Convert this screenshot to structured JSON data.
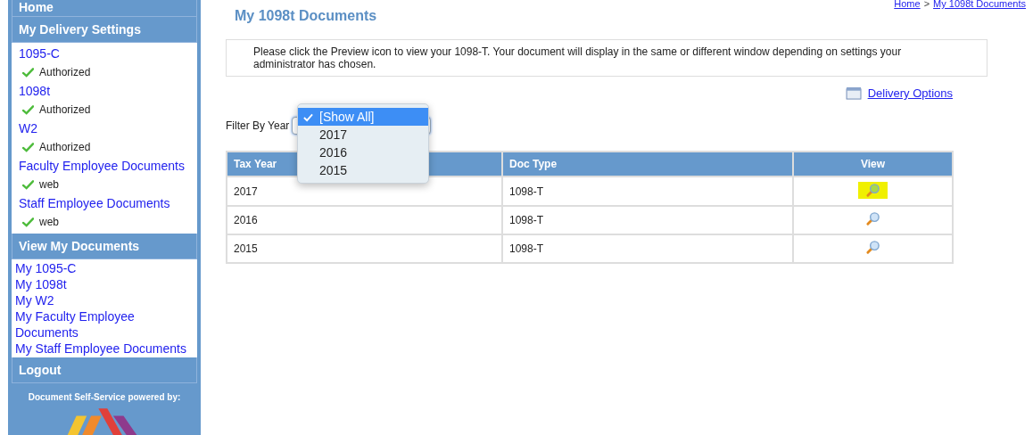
{
  "sidebar": {
    "sections": [
      {
        "title": "Home",
        "kind": "header"
      },
      {
        "title": "My Delivery Settings",
        "kind": "settings",
        "items": [
          {
            "label": "1095-C",
            "status": "Authorized"
          },
          {
            "label": "1098t",
            "status": "Authorized"
          },
          {
            "label": "W2",
            "status": "Authorized"
          },
          {
            "label": "Faculty Employee Documents",
            "status": "web"
          },
          {
            "label": "Staff Employee Documents",
            "status": "web"
          }
        ]
      },
      {
        "title": "View My Documents",
        "kind": "links",
        "items": [
          {
            "label": "My 1095-C"
          },
          {
            "label": "My 1098t"
          },
          {
            "label": "My W2"
          },
          {
            "label": "My Faculty Employee Documents"
          },
          {
            "label": "My Staff Employee Documents"
          }
        ]
      },
      {
        "title": "Logout",
        "kind": "header"
      }
    ],
    "footer": "Document Self-Service powered by:"
  },
  "breadcrumb": [
    "Home",
    "My 1098t Documents"
  ],
  "breadcrumb_separator": ">",
  "page_title": "My 1098t Documents",
  "notice": "Please click the Preview icon to view your 1098-T.  Your document will display in the same or different window depending on settings your administrator has chosen.",
  "delivery_options": "Delivery Options",
  "filter": {
    "label": "Filter By Year",
    "expanded": true,
    "options": [
      {
        "label": "[Show All]",
        "selected": true
      },
      {
        "label": "2017",
        "selected": false
      },
      {
        "label": "2016",
        "selected": false
      },
      {
        "label": "2015",
        "selected": false
      }
    ]
  },
  "table": {
    "columns": [
      "Tax Year",
      "Doc Type",
      "View"
    ],
    "rows": [
      {
        "tax_year": "2017",
        "doc_type": "1098-T",
        "highlighted": true
      },
      {
        "tax_year": "2016",
        "doc_type": "1098-T",
        "highlighted": false
      },
      {
        "tax_year": "2015",
        "doc_type": "1098-T",
        "highlighted": false
      }
    ]
  }
}
